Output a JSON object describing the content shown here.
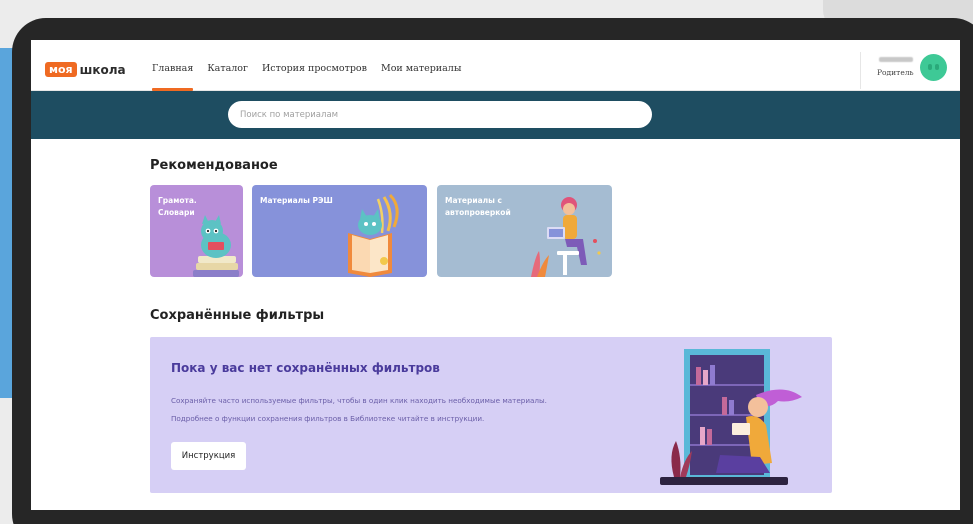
{
  "logo": {
    "part1": "моя",
    "part2": "школа"
  },
  "nav": {
    "items": [
      {
        "label": "Главная",
        "active": true
      },
      {
        "label": "Каталог",
        "active": false
      },
      {
        "label": "История просмотров",
        "active": false
      },
      {
        "label": "Мои материалы",
        "active": false
      }
    ]
  },
  "user": {
    "role": "Родитель"
  },
  "search": {
    "placeholder": "Поиск по материалам"
  },
  "recommended": {
    "title": "Рекомендованое",
    "cards": [
      {
        "label": "Грамота.\nСловари"
      },
      {
        "label": "Материалы РЭШ"
      },
      {
        "label": "Материалы с\nавтопроверкой"
      }
    ]
  },
  "saved_filters": {
    "title": "Сохранённые фильтры",
    "empty_heading": "Пока у вас нет сохранённых фильтров",
    "text_line1": "Сохраняйте часто используемые фильтры, чтобы в один клик находить необходимые материалы.",
    "text_line2": "Подробнее о функции сохранения фильтров в Библиотеке читайте в инструкции.",
    "button_label": "Инструкция"
  },
  "colors": {
    "accent": "#ef6a22",
    "header_band": "#1e4d61",
    "avatar": "#3ec996",
    "panel_bg": "#d6cff5",
    "panel_heading": "#4a3b9c"
  }
}
